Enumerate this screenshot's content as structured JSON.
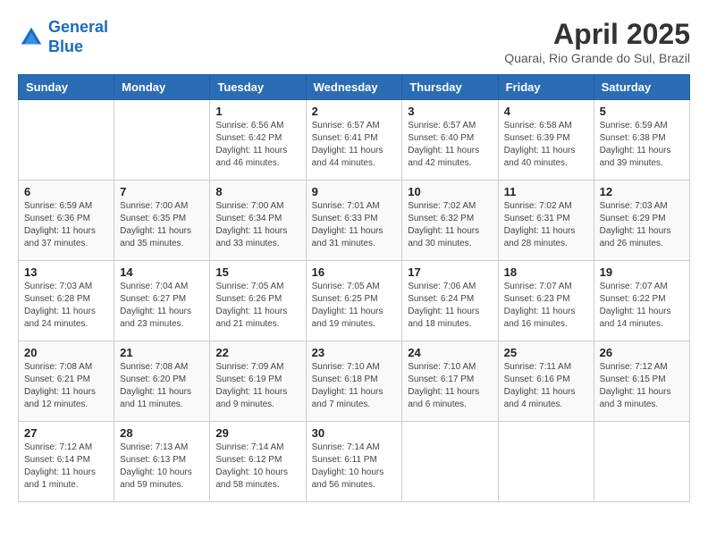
{
  "header": {
    "logo_line1": "General",
    "logo_line2": "Blue",
    "month_title": "April 2025",
    "location": "Quarai, Rio Grande do Sul, Brazil"
  },
  "days_of_week": [
    "Sunday",
    "Monday",
    "Tuesday",
    "Wednesday",
    "Thursday",
    "Friday",
    "Saturday"
  ],
  "weeks": [
    [
      {
        "day": "",
        "info": ""
      },
      {
        "day": "",
        "info": ""
      },
      {
        "day": "1",
        "info": "Sunrise: 6:56 AM\nSunset: 6:42 PM\nDaylight: 11 hours and 46 minutes."
      },
      {
        "day": "2",
        "info": "Sunrise: 6:57 AM\nSunset: 6:41 PM\nDaylight: 11 hours and 44 minutes."
      },
      {
        "day": "3",
        "info": "Sunrise: 6:57 AM\nSunset: 6:40 PM\nDaylight: 11 hours and 42 minutes."
      },
      {
        "day": "4",
        "info": "Sunrise: 6:58 AM\nSunset: 6:39 PM\nDaylight: 11 hours and 40 minutes."
      },
      {
        "day": "5",
        "info": "Sunrise: 6:59 AM\nSunset: 6:38 PM\nDaylight: 11 hours and 39 minutes."
      }
    ],
    [
      {
        "day": "6",
        "info": "Sunrise: 6:59 AM\nSunset: 6:36 PM\nDaylight: 11 hours and 37 minutes."
      },
      {
        "day": "7",
        "info": "Sunrise: 7:00 AM\nSunset: 6:35 PM\nDaylight: 11 hours and 35 minutes."
      },
      {
        "day": "8",
        "info": "Sunrise: 7:00 AM\nSunset: 6:34 PM\nDaylight: 11 hours and 33 minutes."
      },
      {
        "day": "9",
        "info": "Sunrise: 7:01 AM\nSunset: 6:33 PM\nDaylight: 11 hours and 31 minutes."
      },
      {
        "day": "10",
        "info": "Sunrise: 7:02 AM\nSunset: 6:32 PM\nDaylight: 11 hours and 30 minutes."
      },
      {
        "day": "11",
        "info": "Sunrise: 7:02 AM\nSunset: 6:31 PM\nDaylight: 11 hours and 28 minutes."
      },
      {
        "day": "12",
        "info": "Sunrise: 7:03 AM\nSunset: 6:29 PM\nDaylight: 11 hours and 26 minutes."
      }
    ],
    [
      {
        "day": "13",
        "info": "Sunrise: 7:03 AM\nSunset: 6:28 PM\nDaylight: 11 hours and 24 minutes."
      },
      {
        "day": "14",
        "info": "Sunrise: 7:04 AM\nSunset: 6:27 PM\nDaylight: 11 hours and 23 minutes."
      },
      {
        "day": "15",
        "info": "Sunrise: 7:05 AM\nSunset: 6:26 PM\nDaylight: 11 hours and 21 minutes."
      },
      {
        "day": "16",
        "info": "Sunrise: 7:05 AM\nSunset: 6:25 PM\nDaylight: 11 hours and 19 minutes."
      },
      {
        "day": "17",
        "info": "Sunrise: 7:06 AM\nSunset: 6:24 PM\nDaylight: 11 hours and 18 minutes."
      },
      {
        "day": "18",
        "info": "Sunrise: 7:07 AM\nSunset: 6:23 PM\nDaylight: 11 hours and 16 minutes."
      },
      {
        "day": "19",
        "info": "Sunrise: 7:07 AM\nSunset: 6:22 PM\nDaylight: 11 hours and 14 minutes."
      }
    ],
    [
      {
        "day": "20",
        "info": "Sunrise: 7:08 AM\nSunset: 6:21 PM\nDaylight: 11 hours and 12 minutes."
      },
      {
        "day": "21",
        "info": "Sunrise: 7:08 AM\nSunset: 6:20 PM\nDaylight: 11 hours and 11 minutes."
      },
      {
        "day": "22",
        "info": "Sunrise: 7:09 AM\nSunset: 6:19 PM\nDaylight: 11 hours and 9 minutes."
      },
      {
        "day": "23",
        "info": "Sunrise: 7:10 AM\nSunset: 6:18 PM\nDaylight: 11 hours and 7 minutes."
      },
      {
        "day": "24",
        "info": "Sunrise: 7:10 AM\nSunset: 6:17 PM\nDaylight: 11 hours and 6 minutes."
      },
      {
        "day": "25",
        "info": "Sunrise: 7:11 AM\nSunset: 6:16 PM\nDaylight: 11 hours and 4 minutes."
      },
      {
        "day": "26",
        "info": "Sunrise: 7:12 AM\nSunset: 6:15 PM\nDaylight: 11 hours and 3 minutes."
      }
    ],
    [
      {
        "day": "27",
        "info": "Sunrise: 7:12 AM\nSunset: 6:14 PM\nDaylight: 11 hours and 1 minute."
      },
      {
        "day": "28",
        "info": "Sunrise: 7:13 AM\nSunset: 6:13 PM\nDaylight: 10 hours and 59 minutes."
      },
      {
        "day": "29",
        "info": "Sunrise: 7:14 AM\nSunset: 6:12 PM\nDaylight: 10 hours and 58 minutes."
      },
      {
        "day": "30",
        "info": "Sunrise: 7:14 AM\nSunset: 6:11 PM\nDaylight: 10 hours and 56 minutes."
      },
      {
        "day": "",
        "info": ""
      },
      {
        "day": "",
        "info": ""
      },
      {
        "day": "",
        "info": ""
      }
    ]
  ]
}
